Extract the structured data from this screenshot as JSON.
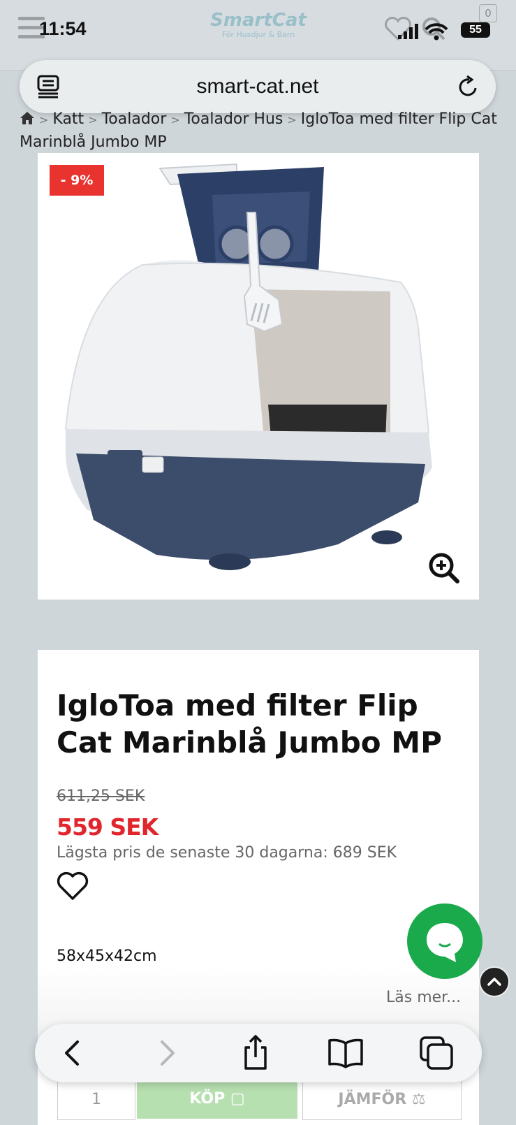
{
  "status_bar": {
    "time": "11:54",
    "battery": "55",
    "cart_count": "0"
  },
  "site": {
    "logo_name": "SmartCat",
    "logo_tagline": "För Husdjur & Barn"
  },
  "browser": {
    "url": "smart-cat.net"
  },
  "breadcrumb": {
    "items": [
      "Katt",
      "Toalador",
      "Toalador Hus",
      "IgloToa med filter Flip Cat Marinblå Jumbo MP"
    ],
    "separator": ">"
  },
  "product": {
    "discount_badge": "- 9%",
    "title": "IgloToa med filter Flip Cat Marinblå Jumbo MP",
    "old_price": "611,25 SEK",
    "price": "559 SEK",
    "lowest_price_label": "Lägsta pris de senaste 30 dagarna:",
    "lowest_price_value": "689 SEK",
    "dimensions": "58x45x42cm",
    "read_more": "Läs mer..."
  },
  "purchase": {
    "quantity": "1",
    "buy_label": "KÖP",
    "compare_label": "JÄMFÖR"
  },
  "colors": {
    "sale_red": "#e0262c",
    "chat_green": "#1aaa4c",
    "buy_green": "#b7e0b0"
  },
  "icons": [
    "menu-icon",
    "heart-icon",
    "search-icon",
    "cart-icon",
    "reader-icon",
    "reload-icon",
    "home-icon",
    "zoom-in-icon",
    "chat-icon",
    "chevron-up-icon",
    "back-icon",
    "forward-icon",
    "share-icon",
    "bookmarks-icon",
    "tabs-icon"
  ]
}
